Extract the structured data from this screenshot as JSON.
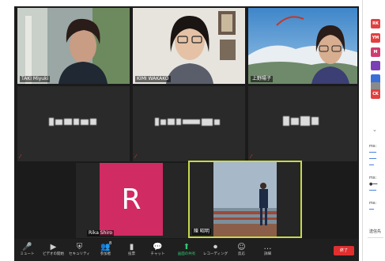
{
  "colors": {
    "stage_bg": "#1b1b1b",
    "active_speaker_border": "#c7d94b",
    "r_avatar_bg": "#d12b63",
    "end_button": "#e02f2f",
    "mute_red": "#e5332a"
  },
  "participants": {
    "p1": {
      "name": "TAKI Miyuki"
    },
    "p2": {
      "name": "KIMI WAKAKO"
    },
    "p3": {
      "name": "上野陽子"
    },
    "p7": {
      "name": "Rika Shiro",
      "initial": "R"
    },
    "p8": {
      "name": "陳 昭明"
    }
  },
  "toolbar": {
    "mute": "ミュート",
    "video": "ビデオの開始",
    "security": "セキュリティ",
    "participants": "参加者",
    "participants_count": "8",
    "polls": "投票",
    "chat": "チャット",
    "share": "画面の共有",
    "record": "レコーディング",
    "reactions": "反応",
    "more": "詳細",
    "end": "終了"
  },
  "sidepanel": {
    "avatars": [
      {
        "text": "RK",
        "color": "#e04141"
      },
      {
        "text": "YM",
        "color": "#e04141"
      },
      {
        "text": "M",
        "color": "#d13b6f"
      },
      {
        "text": "",
        "color": "#7a3fb4"
      },
      {
        "text": "",
        "color": "#3a6fd8"
      },
      {
        "text": "",
        "color": "#8a8a8a"
      },
      {
        "text": "CK",
        "color": "#e04141"
      }
    ],
    "lines": [
      "送信先",
      "ms:",
      "ms:",
      "ms:"
    ]
  }
}
